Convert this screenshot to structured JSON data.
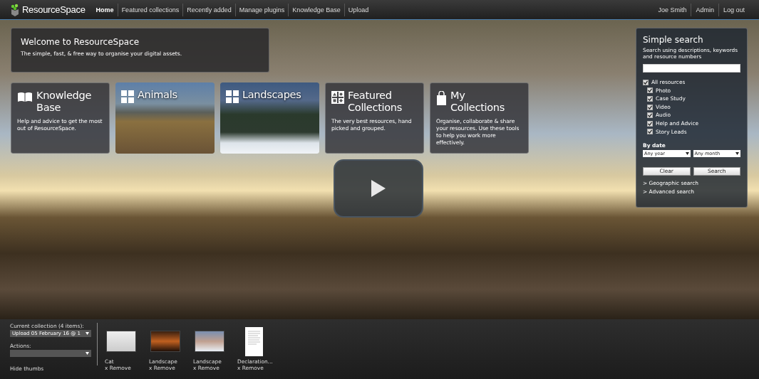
{
  "header": {
    "logo": "ResourceSpace",
    "nav": [
      {
        "label": "Home",
        "selected": true
      },
      {
        "label": "Featured collections",
        "selected": false
      },
      {
        "label": "Recently added",
        "selected": false
      },
      {
        "label": "Manage plugins",
        "selected": false
      },
      {
        "label": "Knowledge Base",
        "selected": false
      },
      {
        "label": "Upload",
        "selected": false
      }
    ],
    "user_links": [
      "Joe Smith",
      "Admin",
      "Log out"
    ]
  },
  "welcome": {
    "title": "Welcome to ResourceSpace",
    "subtitle": "The simple, fast, & free way to organise your digital assets."
  },
  "tiles": [
    {
      "kind": "text",
      "title": "Knowledge Base",
      "text": "Help and advice to get the most out of ResourceSpace."
    },
    {
      "kind": "photo",
      "title": "Animals"
    },
    {
      "kind": "photo",
      "title": "Landscapes"
    },
    {
      "kind": "text",
      "title": "Featured Collections",
      "text": "The very best resources, hand picked and grouped."
    },
    {
      "kind": "text",
      "title": "My Collections",
      "text": "Organise, collaborate & share your resources. Use these tools to help you work more effectively."
    }
  ],
  "search": {
    "title": "Simple search",
    "description": "Search using descriptions, keywords and resource numbers",
    "all_resources": {
      "label": "All resources",
      "checked": true
    },
    "types": [
      {
        "label": "Photo",
        "checked": true
      },
      {
        "label": "Case Study",
        "checked": true
      },
      {
        "label": "Video",
        "checked": true
      },
      {
        "label": "Audio",
        "checked": true
      },
      {
        "label": "Help and Advice",
        "checked": true
      },
      {
        "label": "Story Leads",
        "checked": true
      }
    ],
    "by_date": "By date",
    "year": "Any year",
    "month": "Any month",
    "buttons": [
      "Clear",
      "Search"
    ],
    "links": [
      "> Geographic search",
      "> Advanced search"
    ]
  },
  "footer": {
    "collection_label": "Current collection (4 items):",
    "collection": "Upload 05 February 16 @ 1",
    "actions_label": "Actions:",
    "hide_thumbs": "Hide thumbs",
    "items": [
      {
        "kind": "photo",
        "caption": "Cat",
        "remove": "x Remove"
      },
      {
        "kind": "photo",
        "caption": "Landscape",
        "remove": "x Remove"
      },
      {
        "kind": "photo",
        "caption": "Landscape",
        "remove": "x Remove"
      },
      {
        "kind": "document",
        "caption": "Declaration...",
        "remove": "x Remove"
      }
    ]
  }
}
